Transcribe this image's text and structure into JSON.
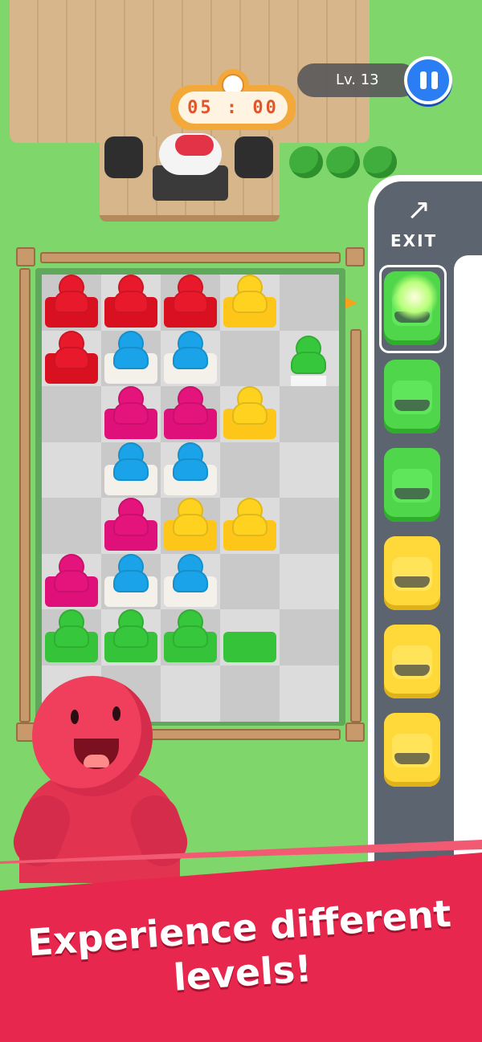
{
  "hud": {
    "timer": "05 : 00",
    "level": "Lv. 13",
    "pause_icon": "pause-icon"
  },
  "road": {
    "exit_label": "EXIT",
    "exit_icon": "turn-right-arrow-icon"
  },
  "cars": [
    "green",
    "green",
    "green",
    "yellow",
    "yellow",
    "yellow"
  ],
  "grid": {
    "rows": 8,
    "cols": 5,
    "occupied": [
      [
        "red",
        "red",
        "red",
        "yellow",
        "empty"
      ],
      [
        "red",
        "blue",
        "blue",
        "empty",
        "green-walking"
      ],
      [
        "empty",
        "pink",
        "pink",
        "yellow",
        "empty"
      ],
      [
        "empty",
        "blue",
        "blue",
        "empty",
        "empty"
      ],
      [
        "empty",
        "pink",
        "yellow",
        "yellow",
        "empty"
      ],
      [
        "pink",
        "blue",
        "blue",
        "empty",
        "empty"
      ],
      [
        "green",
        "green",
        "green",
        "green-seat",
        "empty"
      ],
      [
        "empty",
        "empty",
        "empty",
        "empty",
        "empty"
      ]
    ]
  },
  "colors": {
    "red": "#e8192a",
    "blue": "#1aa3e8",
    "pink": "#e5137c",
    "yellow": "#ffd21f",
    "green": "#37c73c",
    "banner": "#e8274e"
  },
  "banner": {
    "headline": "Experience different levels!"
  }
}
